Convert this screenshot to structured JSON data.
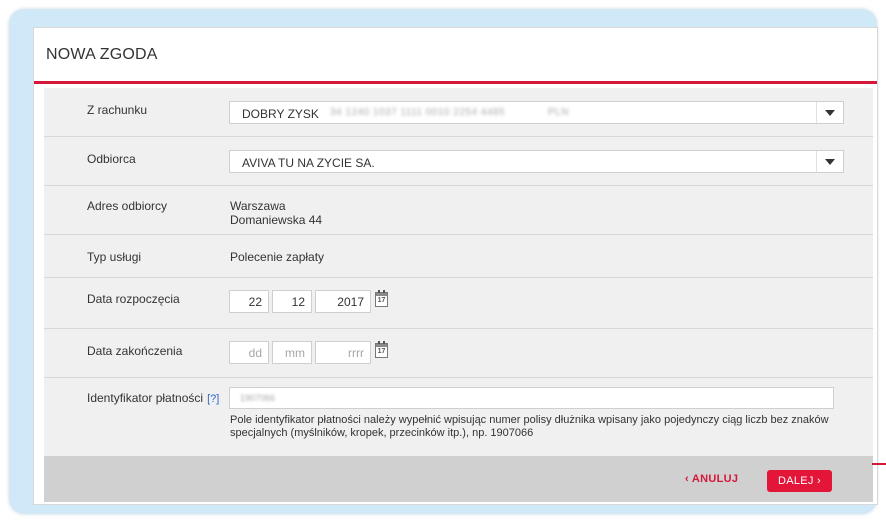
{
  "panel": {
    "title": "NOWA ZGODA"
  },
  "form": {
    "from_account": {
      "label": "Z rachunku",
      "name": "DOBRY ZYSK",
      "number_masked": "34 1240 1037 1111 0010 2254 4485",
      "currency": "PLN"
    },
    "recipient": {
      "label": "Odbiorca",
      "value": "AVIVA TU NA ZYCIE SA."
    },
    "recipient_address": {
      "label": "Adres odbiorcy",
      "city": "Warszawa",
      "street": "Domaniewska 44"
    },
    "service_type": {
      "label": "Typ usługi",
      "value": "Polecenie zapłaty"
    },
    "start_date": {
      "label": "Data rozpoczęcia",
      "day": "22",
      "month": "12",
      "year": "2017",
      "calendar_day": "17"
    },
    "end_date": {
      "label": "Data zakończenia",
      "day_placeholder": "dd",
      "month_placeholder": "mm",
      "year_placeholder": "rrrr",
      "calendar_day": "17"
    },
    "payment_id": {
      "label": "Identyfikator płatności",
      "help": "[?]",
      "value_masked": "1907066",
      "hint": "Pole identyfikator płatności należy wypełnić wpisując numer polisy dłużnika wpisany jako pojedynczy ciąg liczb bez znaków specjalnych (myślników, kropek, przecinków itp.), np. 1907066"
    }
  },
  "footer": {
    "cancel_label": "‹ ANULUJ",
    "next_label": "DALEJ ›"
  },
  "colors": {
    "accent": "#d5173a",
    "frame": "#cfe9f8",
    "form_bg": "#f0f0f0",
    "footer_bg": "#d0d0d0"
  }
}
